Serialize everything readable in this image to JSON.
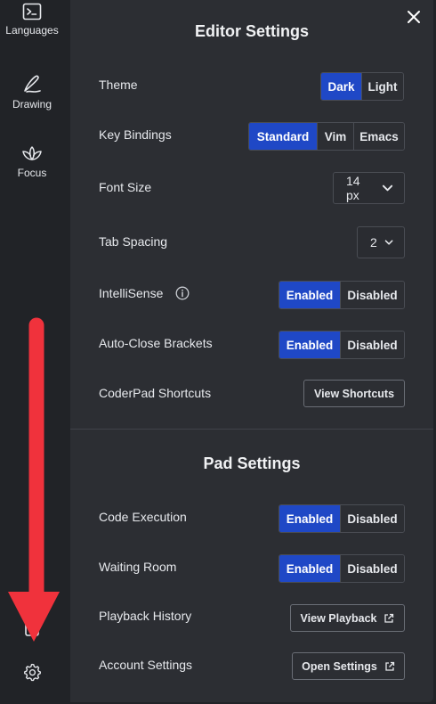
{
  "sidebar": {
    "items": [
      {
        "label": "Languages",
        "icon": "terminal-icon"
      },
      {
        "label": "Drawing",
        "icon": "pen-icon"
      },
      {
        "label": "Focus",
        "icon": "lotus-icon"
      }
    ],
    "bottom_icons": [
      "clipboard-icon",
      "gear-icon"
    ]
  },
  "editor": {
    "title": "Editor Settings",
    "theme": {
      "label": "Theme",
      "options": [
        "Dark",
        "Light"
      ],
      "selected": "Dark"
    },
    "key_bindings": {
      "label": "Key Bindings",
      "options": [
        "Standard",
        "Vim",
        "Emacs"
      ],
      "selected": "Standard"
    },
    "font_size": {
      "label": "Font Size",
      "value": "14 px"
    },
    "tab_spacing": {
      "label": "Tab Spacing",
      "value": "2"
    },
    "intellisense": {
      "label": "IntelliSense",
      "options": [
        "Enabled",
        "Disabled"
      ],
      "selected": "Enabled"
    },
    "auto_close": {
      "label": "Auto-Close Brackets",
      "options": [
        "Enabled",
        "Disabled"
      ],
      "selected": "Enabled"
    },
    "shortcuts": {
      "label": "CoderPad Shortcuts",
      "button": "View Shortcuts"
    }
  },
  "pad": {
    "title": "Pad Settings",
    "code_execution": {
      "label": "Code Execution",
      "options": [
        "Enabled",
        "Disabled"
      ],
      "selected": "Enabled"
    },
    "waiting_room": {
      "label": "Waiting Room",
      "options": [
        "Enabled",
        "Disabled"
      ],
      "selected": "Enabled"
    },
    "playback": {
      "label": "Playback History",
      "button": "View Playback"
    },
    "account": {
      "label": "Account Settings",
      "button": "Open Settings"
    }
  },
  "colors": {
    "accent": "#1f48c6",
    "panel": "#2c2e33",
    "sidebar": "#212327",
    "arrow": "#f0323c"
  }
}
